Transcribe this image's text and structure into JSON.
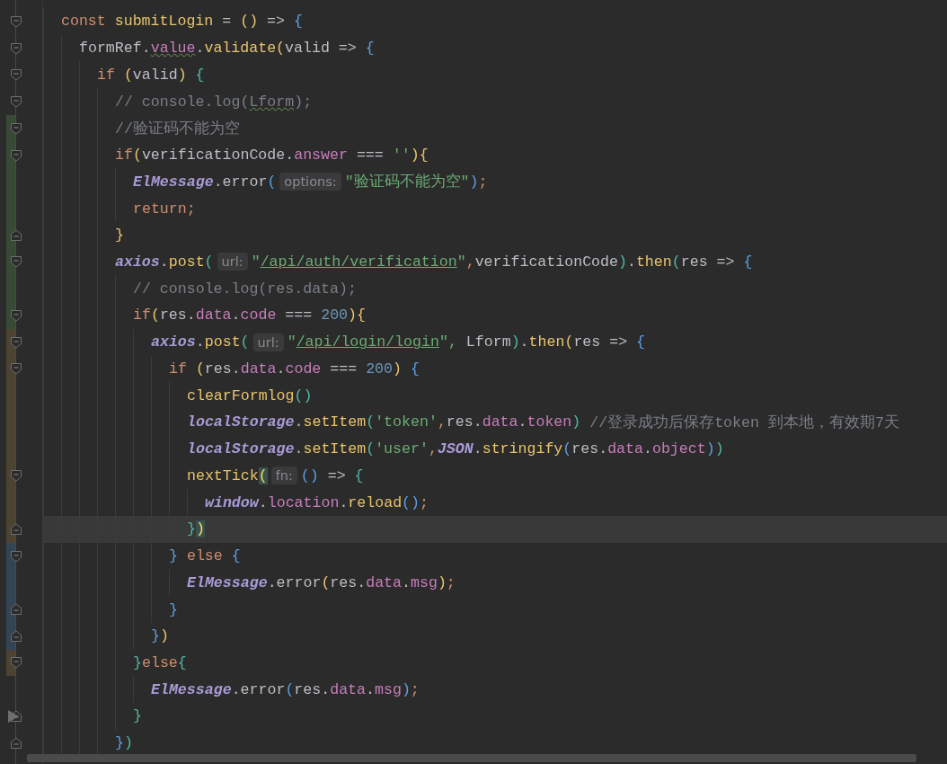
{
  "editor": {
    "lines": [
      {
        "fold_start": true,
        "fold_end": false,
        "current": false,
        "tokens": [
          {
            "kind": "keyword",
            "text": "const "
          },
          {
            "kind": "func",
            "text": "submitLogin"
          },
          {
            "kind": "plain",
            "text": " = "
          },
          {
            "kind": "br1",
            "text": "()"
          },
          {
            "kind": "plain",
            "text": " => "
          },
          {
            "kind": "br2",
            "text": "{"
          }
        ],
        "children": [
          {
            "fold_start": true,
            "fold_end": false,
            "current": false,
            "tokens": [
              {
                "kind": "plain",
                "text": "formRef."
              },
              {
                "kind": "warn",
                "text": "value"
              },
              {
                "kind": "plain",
                "text": "."
              },
              {
                "kind": "func",
                "text": "validate"
              },
              {
                "kind": "br1",
                "text": "("
              },
              {
                "kind": "plain",
                "text": "valid => "
              },
              {
                "kind": "br2",
                "text": "{"
              }
            ],
            "children": [
              {
                "fold_start": true,
                "fold_end": false,
                "current": false,
                "tokens": [
                  {
                    "kind": "keyword",
                    "text": "if "
                  },
                  {
                    "kind": "br1",
                    "text": "("
                  },
                  {
                    "kind": "plain",
                    "text": "valid"
                  },
                  {
                    "kind": "br1",
                    "text": ") "
                  },
                  {
                    "kind": "br3",
                    "text": "{"
                  }
                ],
                "children": [
                  {
                    "fold_start": true,
                    "fold_end": false,
                    "current": false,
                    "tokens": [
                      {
                        "kind": "comment",
                        "text": "// console.log("
                      },
                      {
                        "kind": "comment-warn",
                        "text": "Lform"
                      },
                      {
                        "kind": "comment",
                        "text": ");"
                      }
                    ]
                  },
                  {
                    "fold_start": true,
                    "fold_end": false,
                    "current": false,
                    "color": "#374a36",
                    "tokens": [
                      {
                        "kind": "comment",
                        "text": "//验证码不能为空"
                      }
                    ]
                  },
                  {
                    "fold_start": true,
                    "fold_end": false,
                    "current": false,
                    "color": "#374a36",
                    "tokens": [
                      {
                        "kind": "keyword",
                        "text": "if"
                      },
                      {
                        "kind": "br1",
                        "text": "("
                      },
                      {
                        "kind": "plain",
                        "text": "verificationCode."
                      },
                      {
                        "kind": "field",
                        "text": "answer"
                      },
                      {
                        "kind": "plain",
                        "text": " === "
                      },
                      {
                        "kind": "string",
                        "text": "''"
                      },
                      {
                        "kind": "br1",
                        "text": ")"
                      },
                      {
                        "kind": "br1",
                        "text": "{"
                      }
                    ],
                    "children": [
                      {
                        "fold_start": false,
                        "fold_end": false,
                        "current": false,
                        "color": "#374a36",
                        "tokens": [
                          {
                            "kind": "global",
                            "text": "ElMessage"
                          },
                          {
                            "kind": "plain",
                            "text": ".error"
                          },
                          {
                            "kind": "br2",
                            "text": "("
                          },
                          {
                            "kind": "hint",
                            "text": "options:"
                          },
                          {
                            "kind": "string",
                            "text": "\"验证码不能为空\""
                          },
                          {
                            "kind": "br2",
                            "text": ")"
                          },
                          {
                            "kind": "keyword",
                            "text": ";"
                          }
                        ]
                      },
                      {
                        "fold_start": false,
                        "fold_end": false,
                        "current": false,
                        "color": "#374a36",
                        "tokens": [
                          {
                            "kind": "keyword",
                            "text": "return;"
                          }
                        ]
                      }
                    ]
                  },
                  {
                    "fold_start": false,
                    "fold_end": true,
                    "current": false,
                    "color": "#374a36",
                    "tokens": [
                      {
                        "kind": "br1",
                        "text": "}"
                      }
                    ]
                  },
                  {
                    "fold_start": true,
                    "fold_end": false,
                    "current": false,
                    "color": "#374a36",
                    "tokens": [
                      {
                        "kind": "global",
                        "text": "axios"
                      },
                      {
                        "kind": "plain",
                        "text": "."
                      },
                      {
                        "kind": "func",
                        "text": "post"
                      },
                      {
                        "kind": "br3",
                        "text": "("
                      },
                      {
                        "kind": "hint",
                        "text": "url:"
                      },
                      {
                        "kind": "string",
                        "text": "\""
                      },
                      {
                        "kind": "link",
                        "text": "/api/auth/verification"
                      },
                      {
                        "kind": "string",
                        "text": "\""
                      },
                      {
                        "kind": "keyword",
                        "text": ","
                      },
                      {
                        "kind": "plain",
                        "text": "verificationCode"
                      },
                      {
                        "kind": "br3",
                        "text": ")"
                      },
                      {
                        "kind": "plain",
                        "text": "."
                      },
                      {
                        "kind": "func",
                        "text": "then"
                      },
                      {
                        "kind": "br3",
                        "text": "("
                      },
                      {
                        "kind": "plain",
                        "text": "res => "
                      },
                      {
                        "kind": "br2",
                        "text": "{"
                      }
                    ],
                    "children": [
                      {
                        "fold_start": false,
                        "fold_end": false,
                        "current": false,
                        "color": "#374a36",
                        "tokens": [
                          {
                            "kind": "comment",
                            "text": "// console.log(res.data);"
                          }
                        ]
                      },
                      {
                        "fold_start": true,
                        "fold_end": false,
                        "current": false,
                        "color": "#374a36",
                        "tokens": [
                          {
                            "kind": "keyword",
                            "text": "if"
                          },
                          {
                            "kind": "br1",
                            "text": "("
                          },
                          {
                            "kind": "plain",
                            "text": "res."
                          },
                          {
                            "kind": "field",
                            "text": "data"
                          },
                          {
                            "kind": "plain",
                            "text": "."
                          },
                          {
                            "kind": "field",
                            "text": "code"
                          },
                          {
                            "kind": "plain",
                            "text": " === "
                          },
                          {
                            "kind": "number",
                            "text": "200"
                          },
                          {
                            "kind": "br1",
                            "text": ")"
                          },
                          {
                            "kind": "br1",
                            "text": "{"
                          }
                        ],
                        "children": [
                          {
                            "fold_start": true,
                            "fold_end": false,
                            "current": false,
                            "color": "#4d4332",
                            "tokens": [
                              {
                                "kind": "global",
                                "text": "axios"
                              },
                              {
                                "kind": "plain",
                                "text": "."
                              },
                              {
                                "kind": "func",
                                "text": "post"
                              },
                              {
                                "kind": "br3",
                                "text": "("
                              },
                              {
                                "kind": "hint",
                                "text": "url:"
                              },
                              {
                                "kind": "string",
                                "text": "\""
                              },
                              {
                                "kind": "link",
                                "text": "/api/login/login"
                              },
                              {
                                "kind": "string",
                                "text": "\", "
                              },
                              {
                                "kind": "plain",
                                "text": "Lform"
                              },
                              {
                                "kind": "br3",
                                "text": ")"
                              },
                              {
                                "kind": "plain",
                                "text": "."
                              },
                              {
                                "kind": "func",
                                "text": "then"
                              },
                              {
                                "kind": "br1",
                                "text": "("
                              },
                              {
                                "kind": "plain",
                                "text": "res => "
                              },
                              {
                                "kind": "br2",
                                "text": "{"
                              }
                            ],
                            "children": [
                              {
                                "fold_start": true,
                                "fold_end": false,
                                "current": false,
                                "color": "#4d4332",
                                "tokens": [
                                  {
                                    "kind": "keyword",
                                    "text": "if "
                                  },
                                  {
                                    "kind": "br1",
                                    "text": "("
                                  },
                                  {
                                    "kind": "plain",
                                    "text": "res."
                                  },
                                  {
                                    "kind": "field",
                                    "text": "data"
                                  },
                                  {
                                    "kind": "plain",
                                    "text": "."
                                  },
                                  {
                                    "kind": "field",
                                    "text": "code"
                                  },
                                  {
                                    "kind": "plain",
                                    "text": " === "
                                  },
                                  {
                                    "kind": "number",
                                    "text": "200"
                                  },
                                  {
                                    "kind": "br1",
                                    "text": ") "
                                  },
                                  {
                                    "kind": "br2",
                                    "text": "{"
                                  }
                                ],
                                "children": [
                                  {
                                    "fold_start": false,
                                    "fold_end": false,
                                    "current": false,
                                    "color": "#4d4332",
                                    "tokens": [
                                      {
                                        "kind": "func",
                                        "text": "clearFormlog"
                                      },
                                      {
                                        "kind": "br3",
                                        "text": "()"
                                      }
                                    ]
                                  },
                                  {
                                    "fold_start": false,
                                    "fold_end": false,
                                    "current": false,
                                    "color": "#4d4332",
                                    "tokens": [
                                      {
                                        "kind": "global",
                                        "text": "localStorage"
                                      },
                                      {
                                        "kind": "plain",
                                        "text": "."
                                      },
                                      {
                                        "kind": "func",
                                        "text": "setItem"
                                      },
                                      {
                                        "kind": "br3",
                                        "text": "("
                                      },
                                      {
                                        "kind": "string",
                                        "text": "'token'"
                                      },
                                      {
                                        "kind": "keyword",
                                        "text": ","
                                      },
                                      {
                                        "kind": "plain",
                                        "text": "res."
                                      },
                                      {
                                        "kind": "field",
                                        "text": "data"
                                      },
                                      {
                                        "kind": "plain",
                                        "text": "."
                                      },
                                      {
                                        "kind": "field",
                                        "text": "token"
                                      },
                                      {
                                        "kind": "br3",
                                        "text": ") "
                                      },
                                      {
                                        "kind": "comment",
                                        "text": "//登录成功后保存token 到本地，有效期7天"
                                      }
                                    ]
                                  },
                                  {
                                    "fold_start": false,
                                    "fold_end": false,
                                    "current": false,
                                    "color": "#4d4332",
                                    "tokens": [
                                      {
                                        "kind": "global",
                                        "text": "localStorage"
                                      },
                                      {
                                        "kind": "plain",
                                        "text": "."
                                      },
                                      {
                                        "kind": "func",
                                        "text": "setItem"
                                      },
                                      {
                                        "kind": "br3",
                                        "text": "("
                                      },
                                      {
                                        "kind": "string",
                                        "text": "'user'"
                                      },
                                      {
                                        "kind": "keyword",
                                        "text": ","
                                      },
                                      {
                                        "kind": "global",
                                        "text": "JSON"
                                      },
                                      {
                                        "kind": "plain",
                                        "text": "."
                                      },
                                      {
                                        "kind": "func",
                                        "text": "stringify"
                                      },
                                      {
                                        "kind": "br2",
                                        "text": "("
                                      },
                                      {
                                        "kind": "plain",
                                        "text": "res."
                                      },
                                      {
                                        "kind": "field",
                                        "text": "data"
                                      },
                                      {
                                        "kind": "plain",
                                        "text": "."
                                      },
                                      {
                                        "kind": "field",
                                        "text": "object"
                                      },
                                      {
                                        "kind": "br2",
                                        "text": ")"
                                      },
                                      {
                                        "kind": "br3",
                                        "text": ")"
                                      }
                                    ]
                                  },
                                  {
                                    "fold_start": true,
                                    "fold_end": false,
                                    "current": false,
                                    "color": "#4d4332",
                                    "tokens": [
                                      {
                                        "kind": "func",
                                        "text": "nextTick"
                                      },
                                      {
                                        "kind": "match",
                                        "text": "("
                                      },
                                      {
                                        "kind": "hint",
                                        "text": "fn:"
                                      },
                                      {
                                        "kind": "br2",
                                        "text": "()"
                                      },
                                      {
                                        "kind": "plain",
                                        "text": " => "
                                      },
                                      {
                                        "kind": "br3",
                                        "text": "{"
                                      }
                                    ],
                                    "children": [
                                      {
                                        "fold_start": false,
                                        "fold_end": false,
                                        "current": false,
                                        "color": "#4d4332",
                                        "tokens": [
                                          {
                                            "kind": "global",
                                            "text": "window"
                                          },
                                          {
                                            "kind": "plain",
                                            "text": "."
                                          },
                                          {
                                            "kind": "field",
                                            "text": "location"
                                          },
                                          {
                                            "kind": "plain",
                                            "text": "."
                                          },
                                          {
                                            "kind": "func",
                                            "text": "reload"
                                          },
                                          {
                                            "kind": "br2",
                                            "text": "()"
                                          },
                                          {
                                            "kind": "keyword",
                                            "text": ";"
                                          }
                                        ]
                                      }
                                    ]
                                  },
                                  {
                                    "fold_start": false,
                                    "fold_end": true,
                                    "current": true,
                                    "color": "#4d4332",
                                    "tokens": [
                                      {
                                        "kind": "br3",
                                        "text": "}"
                                      },
                                      {
                                        "kind": "match",
                                        "text": ")"
                                      }
                                    ]
                                  }
                                ]
                              },
                              {
                                "fold_start": true,
                                "fold_end": false,
                                "current": false,
                                "color": "#334554",
                                "tokens": [
                                  {
                                    "kind": "br2",
                                    "text": "} "
                                  },
                                  {
                                    "kind": "keyword",
                                    "text": "else "
                                  },
                                  {
                                    "kind": "br2",
                                    "text": "{"
                                  }
                                ],
                                "children": [
                                  {
                                    "fold_start": false,
                                    "fold_end": false,
                                    "current": false,
                                    "color": "#334554",
                                    "tokens": [
                                      {
                                        "kind": "global",
                                        "text": "ElMessage"
                                      },
                                      {
                                        "kind": "plain",
                                        "text": ".error"
                                      },
                                      {
                                        "kind": "br1",
                                        "text": "("
                                      },
                                      {
                                        "kind": "plain",
                                        "text": "res."
                                      },
                                      {
                                        "kind": "field",
                                        "text": "data"
                                      },
                                      {
                                        "kind": "plain",
                                        "text": "."
                                      },
                                      {
                                        "kind": "field",
                                        "text": "msg"
                                      },
                                      {
                                        "kind": "br1",
                                        "text": ")"
                                      },
                                      {
                                        "kind": "keyword",
                                        "text": ";"
                                      }
                                    ]
                                  }
                                ]
                              },
                              {
                                "fold_start": false,
                                "fold_end": true,
                                "current": false,
                                "color": "#334554",
                                "tokens": [
                                  {
                                    "kind": "br2",
                                    "text": "}"
                                  }
                                ]
                              }
                            ]
                          },
                          {
                            "fold_start": false,
                            "fold_end": true,
                            "current": false,
                            "color": "#334554",
                            "tokens": [
                              {
                                "kind": "br2",
                                "text": "}"
                              },
                              {
                                "kind": "br1",
                                "text": ")"
                              }
                            ]
                          }
                        ]
                      },
                      {
                        "fold_start": true,
                        "fold_end": false,
                        "current": false,
                        "color": "#4d4332",
                        "tokens": [
                          {
                            "kind": "br3",
                            "text": "}"
                          },
                          {
                            "kind": "keyword",
                            "text": "else"
                          },
                          {
                            "kind": "br3",
                            "text": "{"
                          }
                        ],
                        "children": [
                          {
                            "fold_start": false,
                            "fold_end": false,
                            "current": false,
                            "tokens": [
                              {
                                "kind": "global",
                                "text": "ElMessage"
                              },
                              {
                                "kind": "plain",
                                "text": ".error"
                              },
                              {
                                "kind": "br2",
                                "text": "("
                              },
                              {
                                "kind": "plain",
                                "text": "res."
                              },
                              {
                                "kind": "field",
                                "text": "data"
                              },
                              {
                                "kind": "plain",
                                "text": "."
                              },
                              {
                                "kind": "field",
                                "text": "msg"
                              },
                              {
                                "kind": "br2",
                                "text": ")"
                              },
                              {
                                "kind": "keyword",
                                "text": ";"
                              }
                            ]
                          }
                        ]
                      },
                      {
                        "fold_start": false,
                        "fold_end": true,
                        "current": false,
                        "tokens": [
                          {
                            "kind": "br3",
                            "text": "}"
                          }
                        ]
                      }
                    ]
                  },
                  {
                    "fold_start": false,
                    "fold_end": true,
                    "current": false,
                    "tokens": [
                      {
                        "kind": "br2",
                        "text": "}"
                      },
                      {
                        "kind": "br3",
                        "text": ")"
                      }
                    ]
                  }
                ]
              }
            ]
          }
        ]
      }
    ]
  }
}
